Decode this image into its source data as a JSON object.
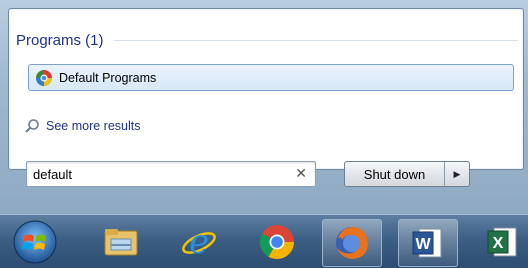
{
  "start_menu": {
    "group_title": "Programs (1)",
    "results": [
      {
        "label": "Default Programs",
        "icon": "default-programs-icon"
      }
    ],
    "see_more_label": "See more results",
    "search": {
      "value": "default",
      "clear_icon": "close-icon"
    },
    "shutdown_label": "Shut down"
  },
  "taskbar": {
    "items": [
      {
        "name": "start-button",
        "icon": "windows-orb-icon"
      },
      {
        "name": "file-explorer",
        "icon": "folder-icon"
      },
      {
        "name": "internet-explorer",
        "icon": "internet-explorer-icon"
      },
      {
        "name": "chrome",
        "icon": "chrome-icon"
      },
      {
        "name": "firefox",
        "icon": "firefox-icon"
      },
      {
        "name": "word",
        "icon": "word-icon"
      },
      {
        "name": "excel",
        "icon": "excel-icon"
      }
    ]
  },
  "colors": {
    "accent": "#1e3287",
    "selection": "#d7e8f8",
    "taskbar": "#3d5f84"
  }
}
